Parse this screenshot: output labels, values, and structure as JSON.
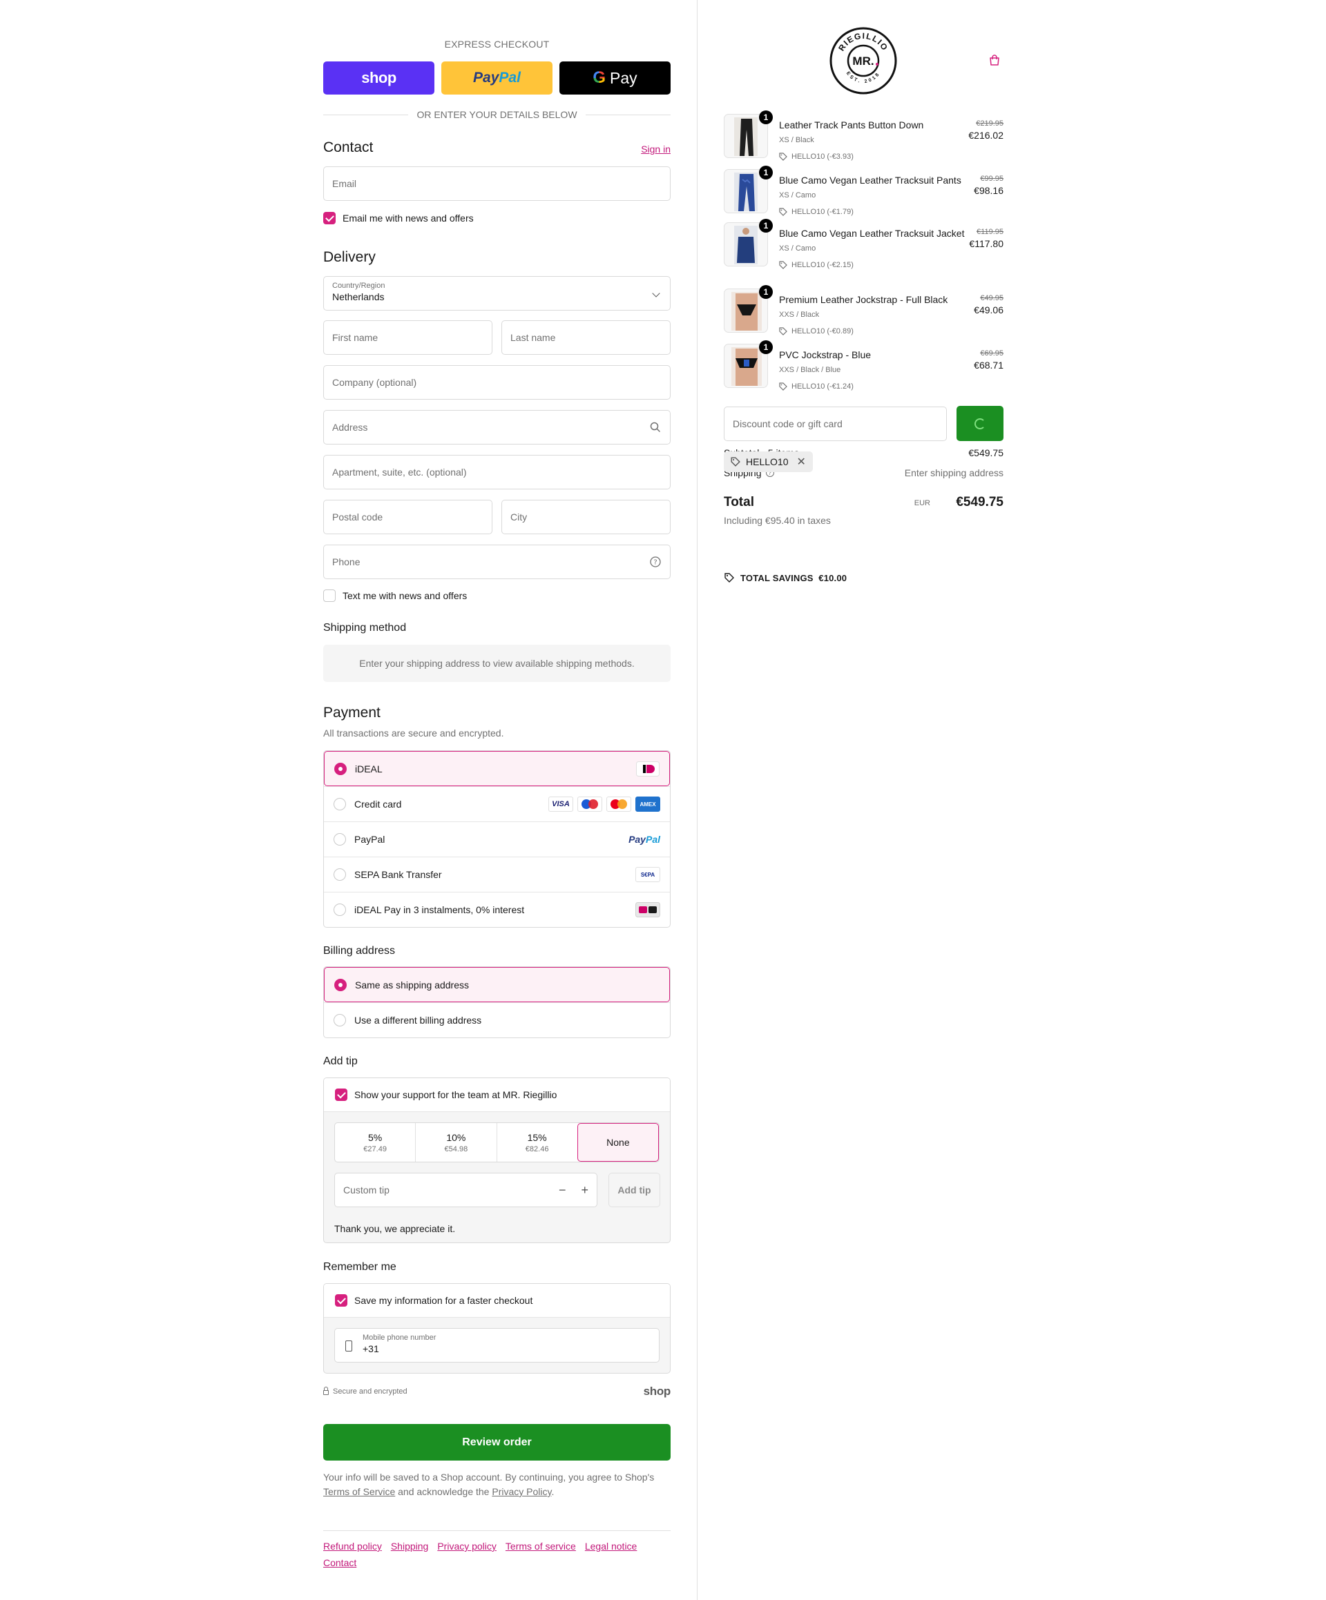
{
  "express": {
    "title": "EXPRESS CHECKOUT",
    "shop_label": "shop",
    "paypal_part1": "Pay",
    "paypal_part2": "Pal",
    "gpay_label": "Pay",
    "or_text": "OR ENTER YOUR DETAILS BELOW"
  },
  "contact": {
    "title": "Contact",
    "sign_in": "Sign in",
    "email_placeholder": "Email",
    "newsletter_label": "Email me with news and offers",
    "newsletter_checked": true
  },
  "delivery": {
    "title": "Delivery",
    "country_label": "Country/Region",
    "country_value": "Netherlands",
    "first_name_placeholder": "First name",
    "last_name_placeholder": "Last name",
    "company_placeholder": "Company (optional)",
    "address_placeholder": "Address",
    "apartment_placeholder": "Apartment, suite, etc. (optional)",
    "postal_placeholder": "Postal code",
    "city_placeholder": "City",
    "phone_placeholder": "Phone",
    "sms_label": "Text me with news and offers",
    "sms_checked": false
  },
  "shipping_method": {
    "title": "Shipping method",
    "notice": "Enter your shipping address to view available shipping methods."
  },
  "payment": {
    "title": "Payment",
    "subtitle": "All transactions are secure and encrypted.",
    "options": [
      {
        "label": "iDEAL",
        "selected": true
      },
      {
        "label": "Credit card",
        "selected": false
      },
      {
        "label": "PayPal",
        "selected": false
      },
      {
        "label": "SEPA Bank Transfer",
        "selected": false
      },
      {
        "label": "iDEAL Pay in 3 instalments, 0% interest",
        "selected": false
      }
    ],
    "card_logos": [
      "VISA",
      "Maestro",
      "Mastercard",
      "AMEX"
    ],
    "paypal_logo_1": "Pay",
    "paypal_logo_2": "Pal",
    "sepa_logo": "S€PA"
  },
  "billing": {
    "title": "Billing address",
    "options": [
      {
        "label": "Same as shipping address",
        "selected": true
      },
      {
        "label": "Use a different billing address",
        "selected": false
      }
    ]
  },
  "tip": {
    "title": "Add tip",
    "support_label": "Show your support for the team at MR. Riegillio",
    "support_checked": true,
    "options": [
      {
        "label": "5%",
        "amount": "€27.49"
      },
      {
        "label": "10%",
        "amount": "€54.98"
      },
      {
        "label": "15%",
        "amount": "€82.46"
      },
      {
        "label": "None",
        "amount": ""
      }
    ],
    "selected": "None",
    "custom_placeholder": "Custom tip",
    "minus": "−",
    "plus": "+",
    "add_label": "Add tip",
    "thanks": "Thank you, we appreciate it."
  },
  "remember": {
    "title": "Remember me",
    "save_label": "Save my information for a faster checkout",
    "save_checked": true,
    "phone_label": "Mobile phone number",
    "phone_value": "+31",
    "secure_label": "Secure and encrypted",
    "shop_label": "shop"
  },
  "review_button": "Review order",
  "legal": {
    "text1": "Your info will be saved to a Shop account. By continuing, you agree to Shop's",
    "terms": "Terms of Service",
    "text2": "and acknowledge the",
    "privacy": "Privacy Policy",
    "text3": "."
  },
  "footer_links": [
    "Refund policy",
    "Shipping",
    "Privacy policy",
    "Terms of service",
    "Legal notice",
    "Contact"
  ],
  "brand": {
    "name_top": "RIEGILLIO",
    "name_center": "MR.",
    "est": "EST. 2018"
  },
  "cart": {
    "items": [
      {
        "name": "Leather Track Pants Button Down",
        "variant": "XS / Black",
        "discount": "HELLO10 (-€3.93)",
        "old_price": "€219.95",
        "price": "€216.02",
        "qty": "1"
      },
      {
        "name": "Blue Camo Vegan Leather Tracksuit Pants",
        "variant": "XS / Camo",
        "discount": "HELLO10 (-€1.79)",
        "old_price": "€99.95",
        "price": "€98.16",
        "qty": "1"
      },
      {
        "name": "Blue Camo Vegan Leather Tracksuit Jacket",
        "variant": "XS / Camo",
        "discount": "HELLO10 (-€2.15)",
        "old_price": "€119.95",
        "price": "€117.80",
        "qty": "1"
      },
      {
        "name": "Premium Leather Jockstrap - Full Black",
        "variant": "XXS / Black",
        "discount": "HELLO10 (-€0.89)",
        "old_price": "€49.95",
        "price": "€49.06",
        "qty": "1"
      },
      {
        "name": "PVC Jockstrap - Blue",
        "variant": "XXS / Black / Blue",
        "discount": "HELLO10 (-€1.24)",
        "old_price": "€69.95",
        "price": "€68.71",
        "qty": "1"
      }
    ],
    "discount_placeholder": "Discount code or gift card",
    "applied_code": "HELLO10",
    "subtotal_label": "Subtotal · 5 items",
    "subtotal_value": "€549.75",
    "shipping_label": "Shipping",
    "shipping_value": "Enter shipping address",
    "total_label": "Total",
    "currency": "EUR",
    "total_value": "€549.75",
    "taxes": "Including €95.40 in taxes",
    "savings": "TOTAL SAVINGS  €10.00"
  },
  "colors": {
    "accent": "#d6207e",
    "primary_button": "#1b8f22",
    "shop_pay": "#5a31f4",
    "paypal": "#ffc439"
  }
}
